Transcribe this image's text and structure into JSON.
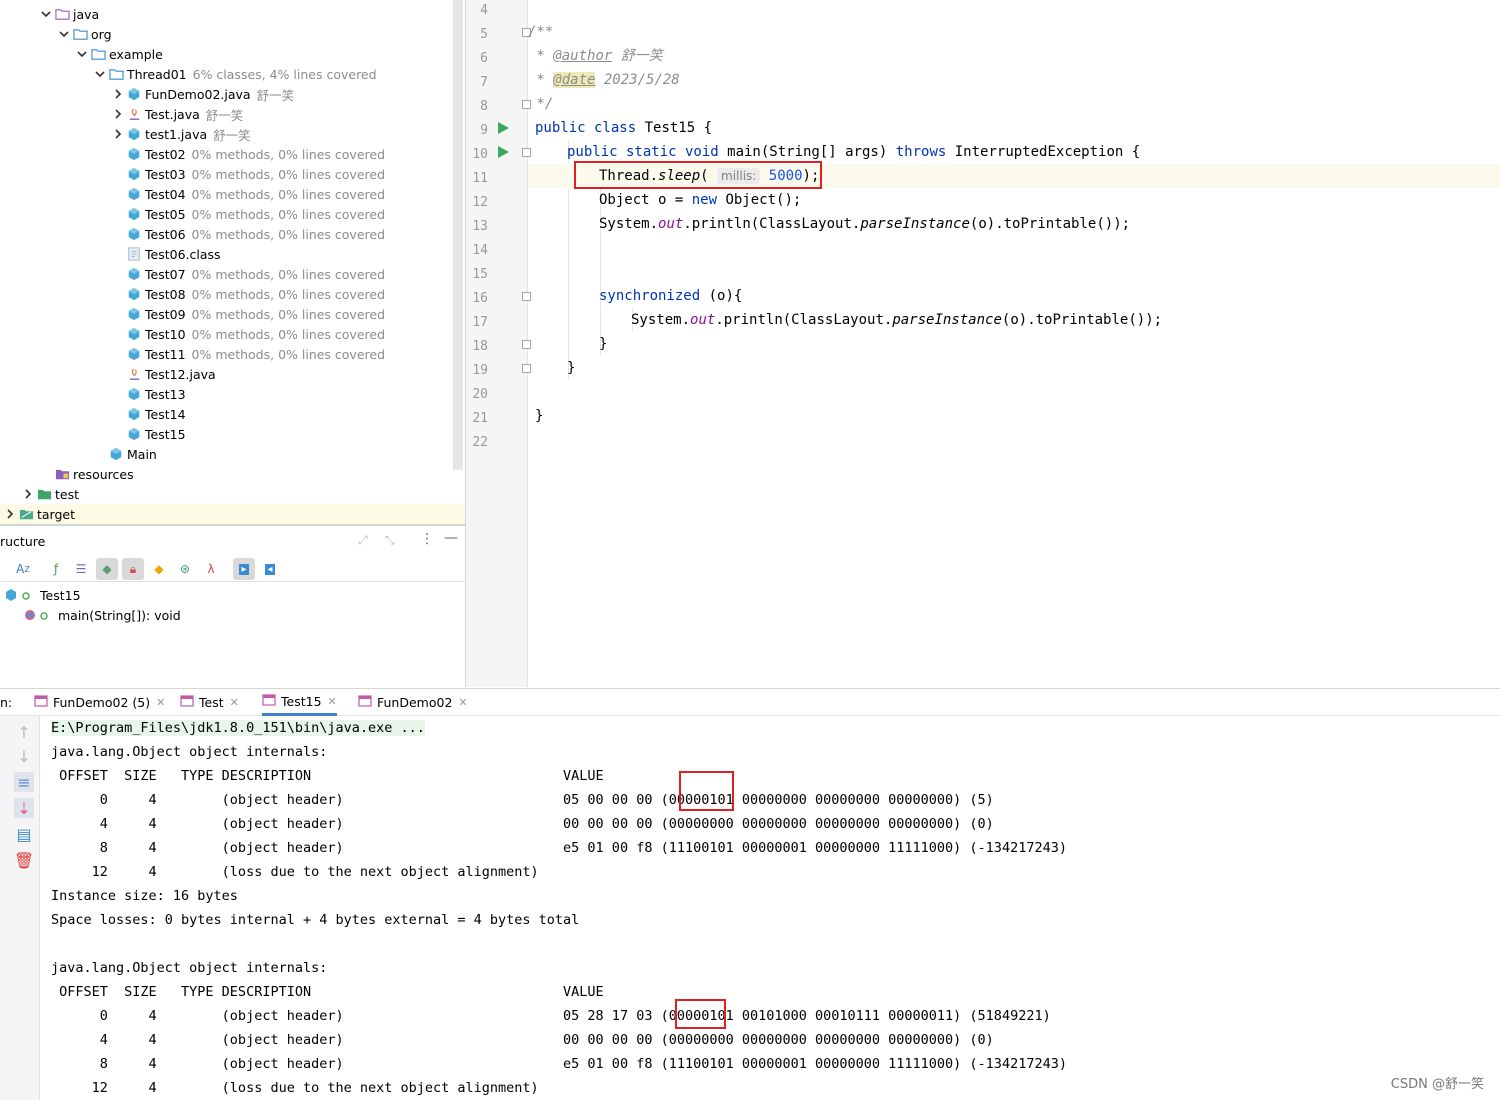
{
  "tree": {
    "items": [
      {
        "label": "java",
        "meta": "",
        "icon": "folder-src-icon"
      },
      {
        "label": "org",
        "meta": "",
        "icon": "package-icon"
      },
      {
        "label": "example",
        "meta": "",
        "icon": "package-icon"
      },
      {
        "label": "Thread01",
        "meta": "6% classes, 4% lines covered",
        "icon": "package-icon"
      },
      {
        "label": "FunDemo02.java",
        "meta": "舒一笑",
        "icon": "class-icon"
      },
      {
        "label": "Test.java",
        "meta": "舒一笑",
        "icon": "java-file-icon"
      },
      {
        "label": "test1.java",
        "meta": "舒一笑",
        "icon": "class-icon"
      },
      {
        "label": "Test02",
        "meta": "0% methods, 0% lines covered",
        "icon": "class-icon"
      },
      {
        "label": "Test03",
        "meta": "0% methods, 0% lines covered",
        "icon": "class-icon"
      },
      {
        "label": "Test04",
        "meta": "0% methods, 0% lines covered",
        "icon": "class-icon"
      },
      {
        "label": "Test05",
        "meta": "0% methods, 0% lines covered",
        "icon": "class-icon"
      },
      {
        "label": "Test06",
        "meta": "0% methods, 0% lines covered",
        "icon": "class-icon"
      },
      {
        "label": "Test06.class",
        "meta": "",
        "icon": "class-file-icon"
      },
      {
        "label": "Test07",
        "meta": "0% methods, 0% lines covered",
        "icon": "class-icon"
      },
      {
        "label": "Test08",
        "meta": "0% methods, 0% lines covered",
        "icon": "class-icon"
      },
      {
        "label": "Test09",
        "meta": "0% methods, 0% lines covered",
        "icon": "class-icon"
      },
      {
        "label": "Test10",
        "meta": "0% methods, 0% lines covered",
        "icon": "class-icon"
      },
      {
        "label": "Test11",
        "meta": "0% methods, 0% lines covered",
        "icon": "class-icon"
      },
      {
        "label": "Test12.java",
        "meta": "",
        "icon": "java-file-icon"
      },
      {
        "label": "Test13",
        "meta": "",
        "icon": "class-icon"
      },
      {
        "label": "Test14",
        "meta": "",
        "icon": "class-icon"
      },
      {
        "label": "Test15",
        "meta": "",
        "icon": "class-icon"
      },
      {
        "label": "Main",
        "meta": "",
        "icon": "class-icon"
      },
      {
        "label": "resources",
        "meta": "",
        "icon": "resources-folder-icon"
      },
      {
        "label": "test",
        "meta": "",
        "icon": "test-folder-icon"
      },
      {
        "label": "target",
        "meta": "",
        "icon": "excluded-folder-icon"
      }
    ]
  },
  "structure": {
    "title": "ructure",
    "class_name": "Test15",
    "method": "main(String[]): void"
  },
  "editor": {
    "line_numbers": [
      "4",
      "5",
      "6",
      "7",
      "8",
      "9",
      "10",
      "11",
      "12",
      "13",
      "14",
      "15",
      "16",
      "17",
      "18",
      "19",
      "20",
      "21",
      "22"
    ],
    "javadoc_open": "/**",
    "author_prefix": " * ",
    "author_tag": "@author",
    "author_value": " 舒一笑",
    "date_prefix": " * ",
    "date_tag": "@date",
    "date_value": " 2023/5/28",
    "javadoc_close": " */",
    "l9_kw": "public class",
    "l9_rest": " Test15 {",
    "l10_kw1": "public static void",
    "l10_name": " main(String[] args) ",
    "l10_kw2": "throws",
    "l10_rest": " InterruptedException {",
    "l11_a": "Thread.",
    "l11_b": "sleep",
    "l11_c": "( ",
    "l11_hint": "millis:",
    "l11_num": "5000",
    "l11_d": ");",
    "l12_a": "Object o = ",
    "l12_kw": "new",
    "l12_b": " Object();",
    "l13_a": "System.",
    "l13_out": "out",
    "l13_b": ".println(ClassLayout.",
    "l13_parse": "parseInstance",
    "l13_c": "(o).toPrintable());",
    "l16_kw": "synchronized",
    "l16_rest": " (o){",
    "l17_a": "System.",
    "l17_out": "out",
    "l17_b": ".println(ClassLayout.",
    "l17_parse": "parseInstance",
    "l17_c": "(o).toPrintable());",
    "brace_close": "}",
    "accent": "#0033b3"
  },
  "run": {
    "label": "n:",
    "tabs": [
      {
        "label": "FunDemo02 (5)",
        "closable": true
      },
      {
        "label": "Test",
        "closable": true
      },
      {
        "label": "Test15",
        "closable": true
      },
      {
        "label": "FunDemo02",
        "closable": true
      }
    ],
    "console_lines": [
      "E:\\Program_Files\\jdk1.8.0_151\\bin\\java.exe ...",
      "java.lang.Object object internals:",
      " OFFSET  SIZE   TYPE DESCRIPTION                               VALUE",
      "      0     4        (object header)                           05 00 00 00 (00000101 00000000 00000000 00000000) (5)",
      "      4     4        (object header)                           00 00 00 00 (00000000 00000000 00000000 00000000) (0)",
      "      8     4        (object header)                           e5 01 00 f8 (11100101 00000001 00000000 11111000) (-134217243)",
      "     12     4        (loss due to the next object alignment)",
      "Instance size: 16 bytes",
      "Space losses: 0 bytes internal + 4 bytes external = 4 bytes total",
      "",
      "java.lang.Object object internals:",
      " OFFSET  SIZE   TYPE DESCRIPTION                               VALUE",
      "      0     4        (object header)                           05 28 17 03 (00000101 00101000 00010111 00000011) (51849221)",
      "      4     4        (object header)                           00 00 00 00 (00000000 00000000 00000000 00000000) (0)",
      "      8     4        (object header)                           e5 01 00 f8 (11100101 00000001 00000000 11111000) (-134217243)",
      "     12     4        (loss due to the next object alignment)"
    ]
  },
  "watermark": "CSDN @舒一笑"
}
